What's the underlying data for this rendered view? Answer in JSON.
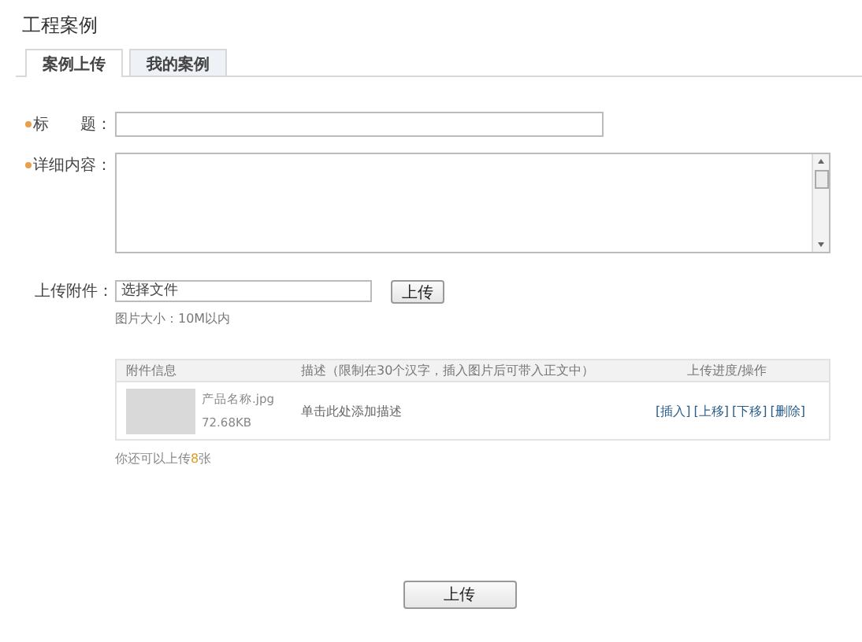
{
  "page_title": "工程案例",
  "tabs": [
    {
      "label": "案例上传",
      "selected": true
    },
    {
      "label": "我的案例",
      "selected": false
    }
  ],
  "fields": [
    {
      "kind": "input",
      "label": "标　　题：",
      "required": true
    },
    {
      "kind": "textarea",
      "label": "详细内容：",
      "required": true
    }
  ],
  "attachment": {
    "label": "上传附件：",
    "file_value": "选择文件",
    "upload_button": "上传",
    "hint": "图片大小：10M以内"
  },
  "attachments_table": {
    "columns": [
      "附件信息",
      "描述（限制在30个汉字，插入图片后可带入正文中）",
      "上传进度/操作"
    ],
    "rows": [
      {
        "name": "产品名称.jpg",
        "size": "72.68KB",
        "description": "单击此处添加描述",
        "actions": [
          "[插入]",
          "[上移]",
          "[下移]",
          "[删除]"
        ]
      }
    ]
  },
  "remaining": {
    "prefix": "你还可以上传",
    "count": "8",
    "suffix": "张"
  },
  "submit_button": "上传"
}
